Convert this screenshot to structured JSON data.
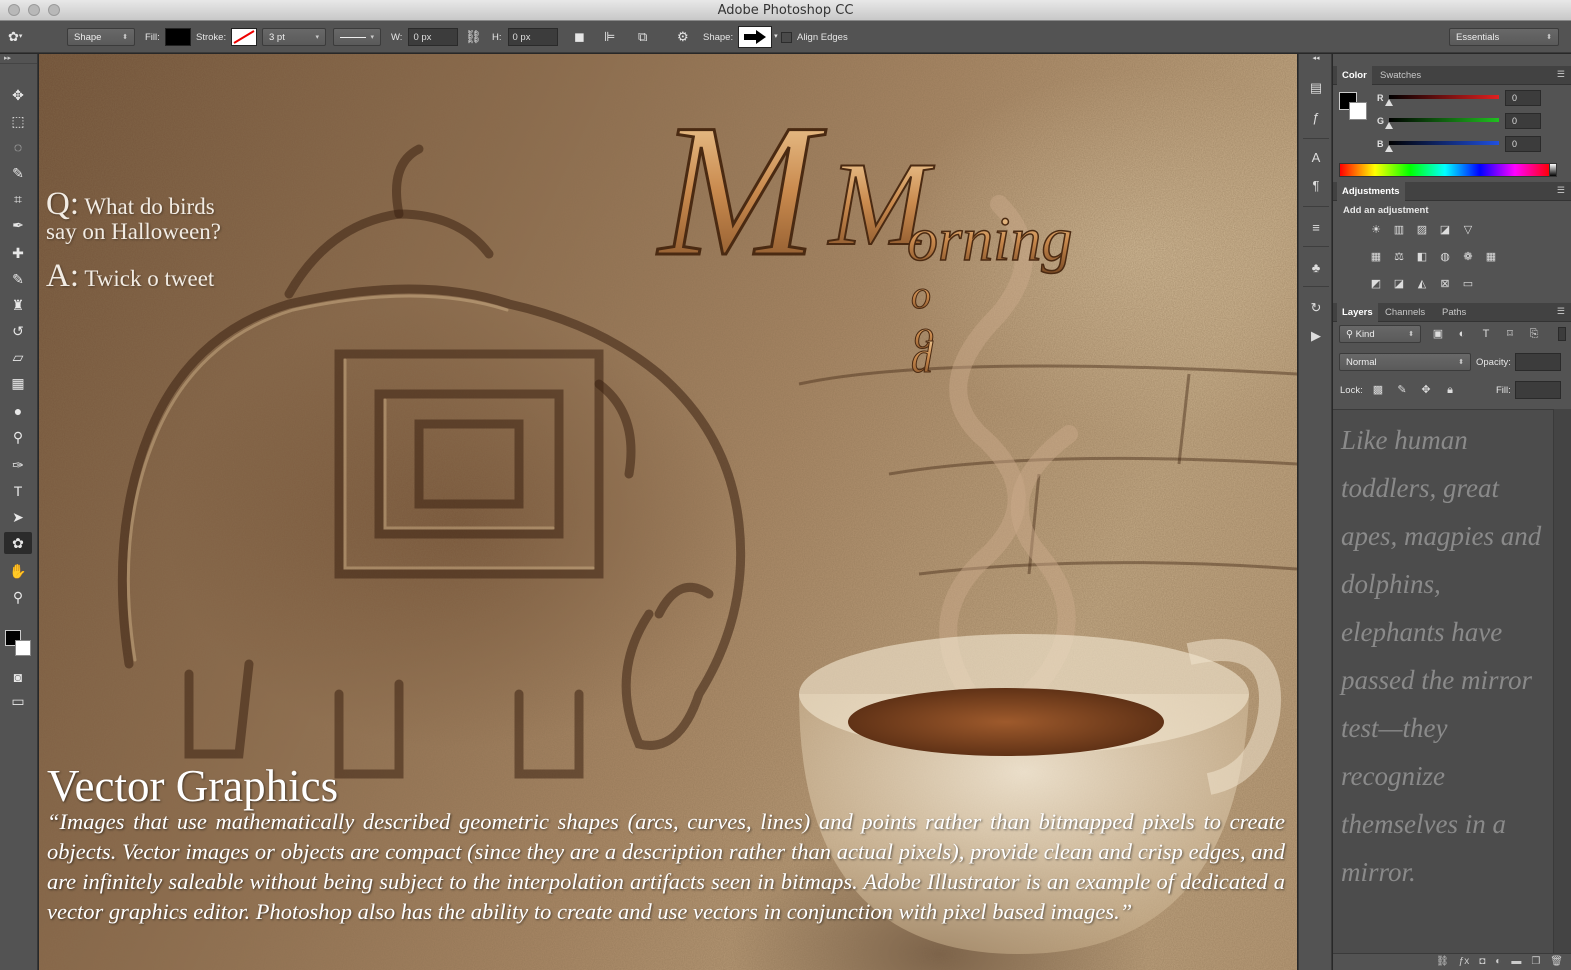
{
  "window": {
    "title": "Adobe Photoshop CC"
  },
  "options_bar": {
    "tool_icon": "custom-shape-tool-icon",
    "mode": "Shape",
    "fill_label": "Fill:",
    "fill_color": "#000000",
    "stroke_label": "Stroke:",
    "stroke_width": "3 pt",
    "width_label": "W:",
    "width_value": "0 px",
    "height_label": "H:",
    "height_value": "0 px",
    "shape_label": "Shape:",
    "align_edges_label": "Align Edges",
    "align_edges_checked": false,
    "workspace": "Essentials"
  },
  "tools": [
    {
      "name": "move-tool",
      "glyph": "✥"
    },
    {
      "name": "marquee-tool",
      "glyph": "⬚"
    },
    {
      "name": "lasso-tool",
      "glyph": "◌"
    },
    {
      "name": "quick-selection-tool",
      "glyph": "✎"
    },
    {
      "name": "crop-tool",
      "glyph": "⌗"
    },
    {
      "name": "eyedropper-tool",
      "glyph": "✒"
    },
    {
      "name": "healing-brush-tool",
      "glyph": "✚"
    },
    {
      "name": "brush-tool",
      "glyph": "✎"
    },
    {
      "name": "clone-stamp-tool",
      "glyph": "♜"
    },
    {
      "name": "history-brush-tool",
      "glyph": "↺"
    },
    {
      "name": "eraser-tool",
      "glyph": "▱"
    },
    {
      "name": "gradient-tool",
      "glyph": "▦"
    },
    {
      "name": "blur-tool",
      "glyph": "●"
    },
    {
      "name": "dodge-tool",
      "glyph": "⚲"
    },
    {
      "name": "pen-tool",
      "glyph": "✑"
    },
    {
      "name": "type-tool",
      "glyph": "T"
    },
    {
      "name": "path-selection-tool",
      "glyph": "➤"
    },
    {
      "name": "custom-shape-tool",
      "glyph": "✿",
      "active": true
    },
    {
      "name": "hand-tool",
      "glyph": "✋"
    },
    {
      "name": "zoom-tool",
      "glyph": "⚲"
    }
  ],
  "canvas": {
    "riddle_q_letter": "Q:",
    "riddle_q_line1": "What do birds",
    "riddle_q_line2": "say on Halloween?",
    "riddle_a_letter": "A:",
    "riddle_a_text": "Twick o tweet",
    "logo_initial_1": "M",
    "logo_initial_2": "M",
    "logo_word_1": "orning",
    "logo_word_2_letters": [
      "o",
      "o",
      "d"
    ],
    "heading": "Vector Graphics",
    "body": "“Images that use mathematically described geometric shapes (arcs, curves, lines) and points rather than bitmapped pixels to create objects. Vector images or objects are compact (since they are a description rather than actual pixels), provide clean and crisp edges, and are infinitely saleable without being subject to the interpolation artifacts seen in bitmaps. Adobe Illustrator is an example of dedicated a vector graphics editor. Photoshop also has the ability to create and use vectors in conjunction with pixel based images.”"
  },
  "color_panel": {
    "tabs": [
      "Color",
      "Swatches"
    ],
    "active_tab": "Color",
    "channels": [
      {
        "label": "R",
        "value": "0",
        "color": "#e02020"
      },
      {
        "label": "G",
        "value": "0",
        "color": "#20c020"
      },
      {
        "label": "B",
        "value": "0",
        "color": "#2050e0"
      }
    ]
  },
  "adjustments_panel": {
    "tab": "Adjustments",
    "subtitle": "Add an adjustment"
  },
  "layers_panel": {
    "tabs": [
      "Layers",
      "Channels",
      "Paths"
    ],
    "active_tab": "Layers",
    "filter_kind": "Kind",
    "blend_mode": "Normal",
    "opacity_label": "Opacity:",
    "lock_label": "Lock:",
    "fill_label": "Fill:",
    "text_preview": "Like human toddlers, great apes, magpies and dolphins, elephants have passed the mirror test—they recognize themselves in a mirror."
  }
}
